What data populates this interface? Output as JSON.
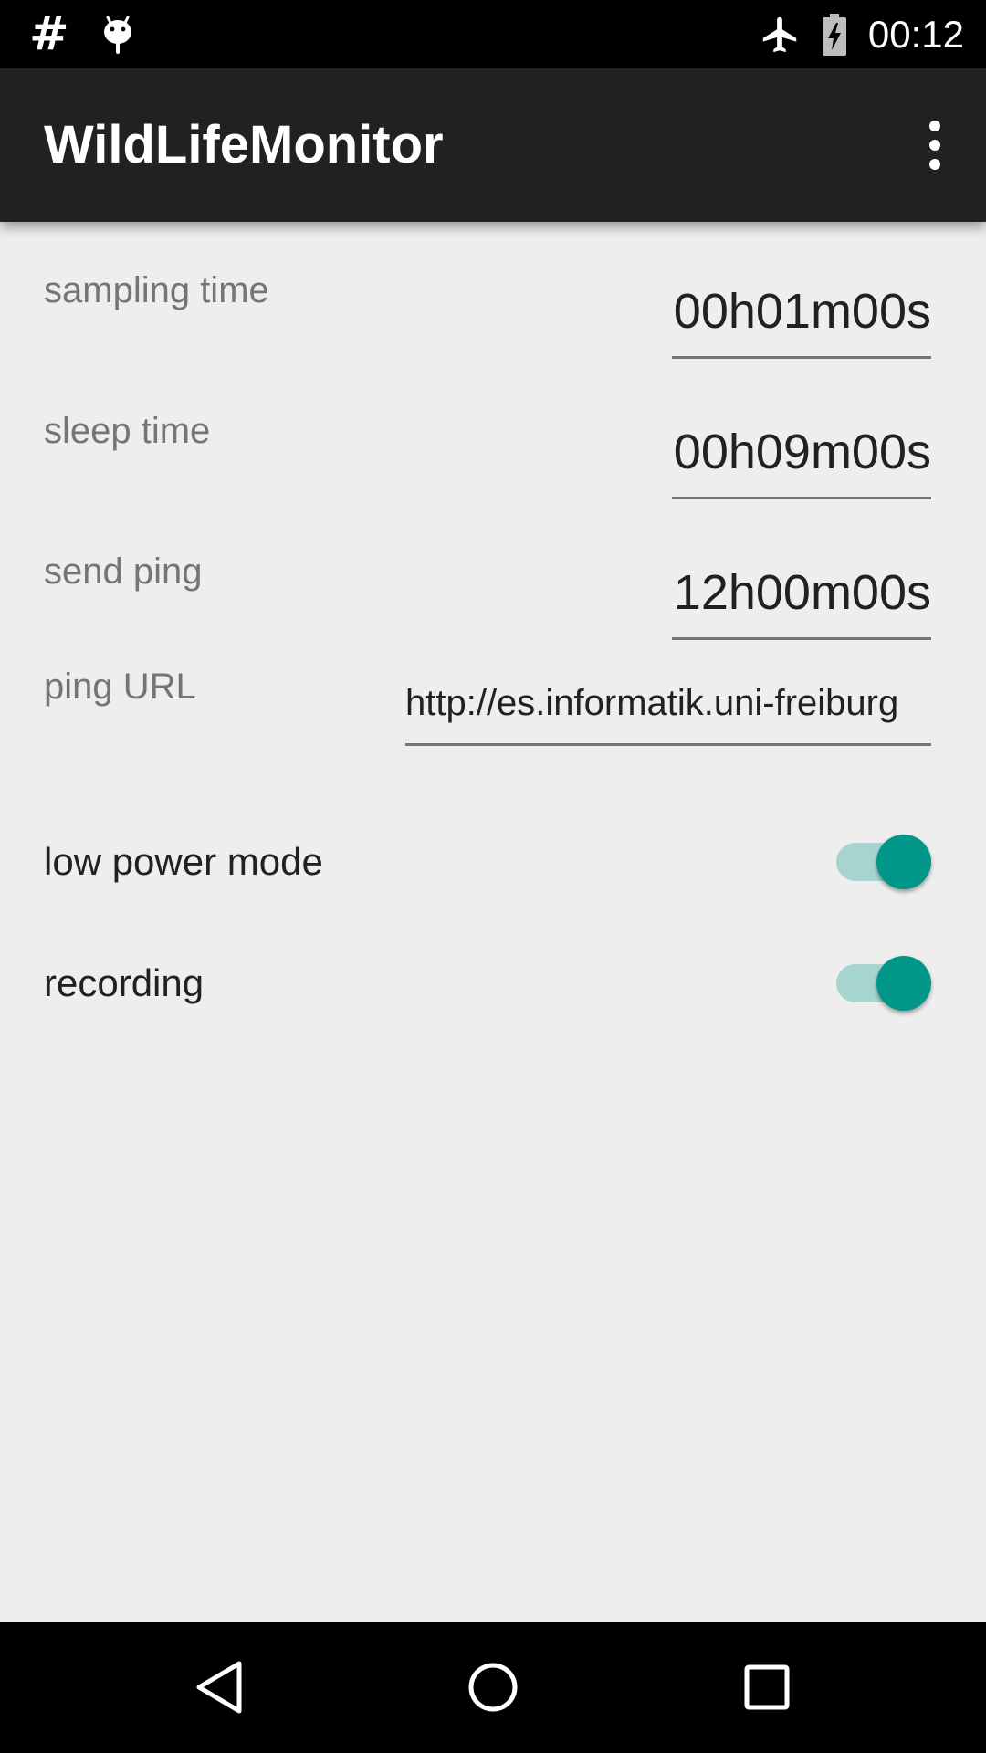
{
  "status_bar": {
    "notification_icons": [
      "hash-icon",
      "android-debug-icon"
    ],
    "system_icons": [
      "airplane-mode-icon",
      "battery-charging-icon"
    ],
    "time": "00:12"
  },
  "app_bar": {
    "title": "WildLifeMonitor",
    "menu_icon": "overflow-menu-icon"
  },
  "settings": {
    "sampling_time": {
      "label": "sampling time",
      "value": "00h01m00s"
    },
    "sleep_time": {
      "label": "sleep time",
      "value": "00h09m00s"
    },
    "send_ping": {
      "label": "send ping",
      "value": "12h00m00s"
    },
    "ping_url": {
      "label": "ping URL",
      "value": "http://es.informatik.uni-freiburg"
    },
    "low_power_mode": {
      "label": "low power mode",
      "enabled": true
    },
    "recording": {
      "label": "recording",
      "enabled": true
    }
  },
  "nav_bar": {
    "buttons": [
      "back-icon",
      "home-icon",
      "recents-icon"
    ]
  },
  "colors": {
    "accent": "#009688",
    "accent_track": "#a6d5d0",
    "app_bar": "#212121",
    "background": "#eeeeee"
  }
}
